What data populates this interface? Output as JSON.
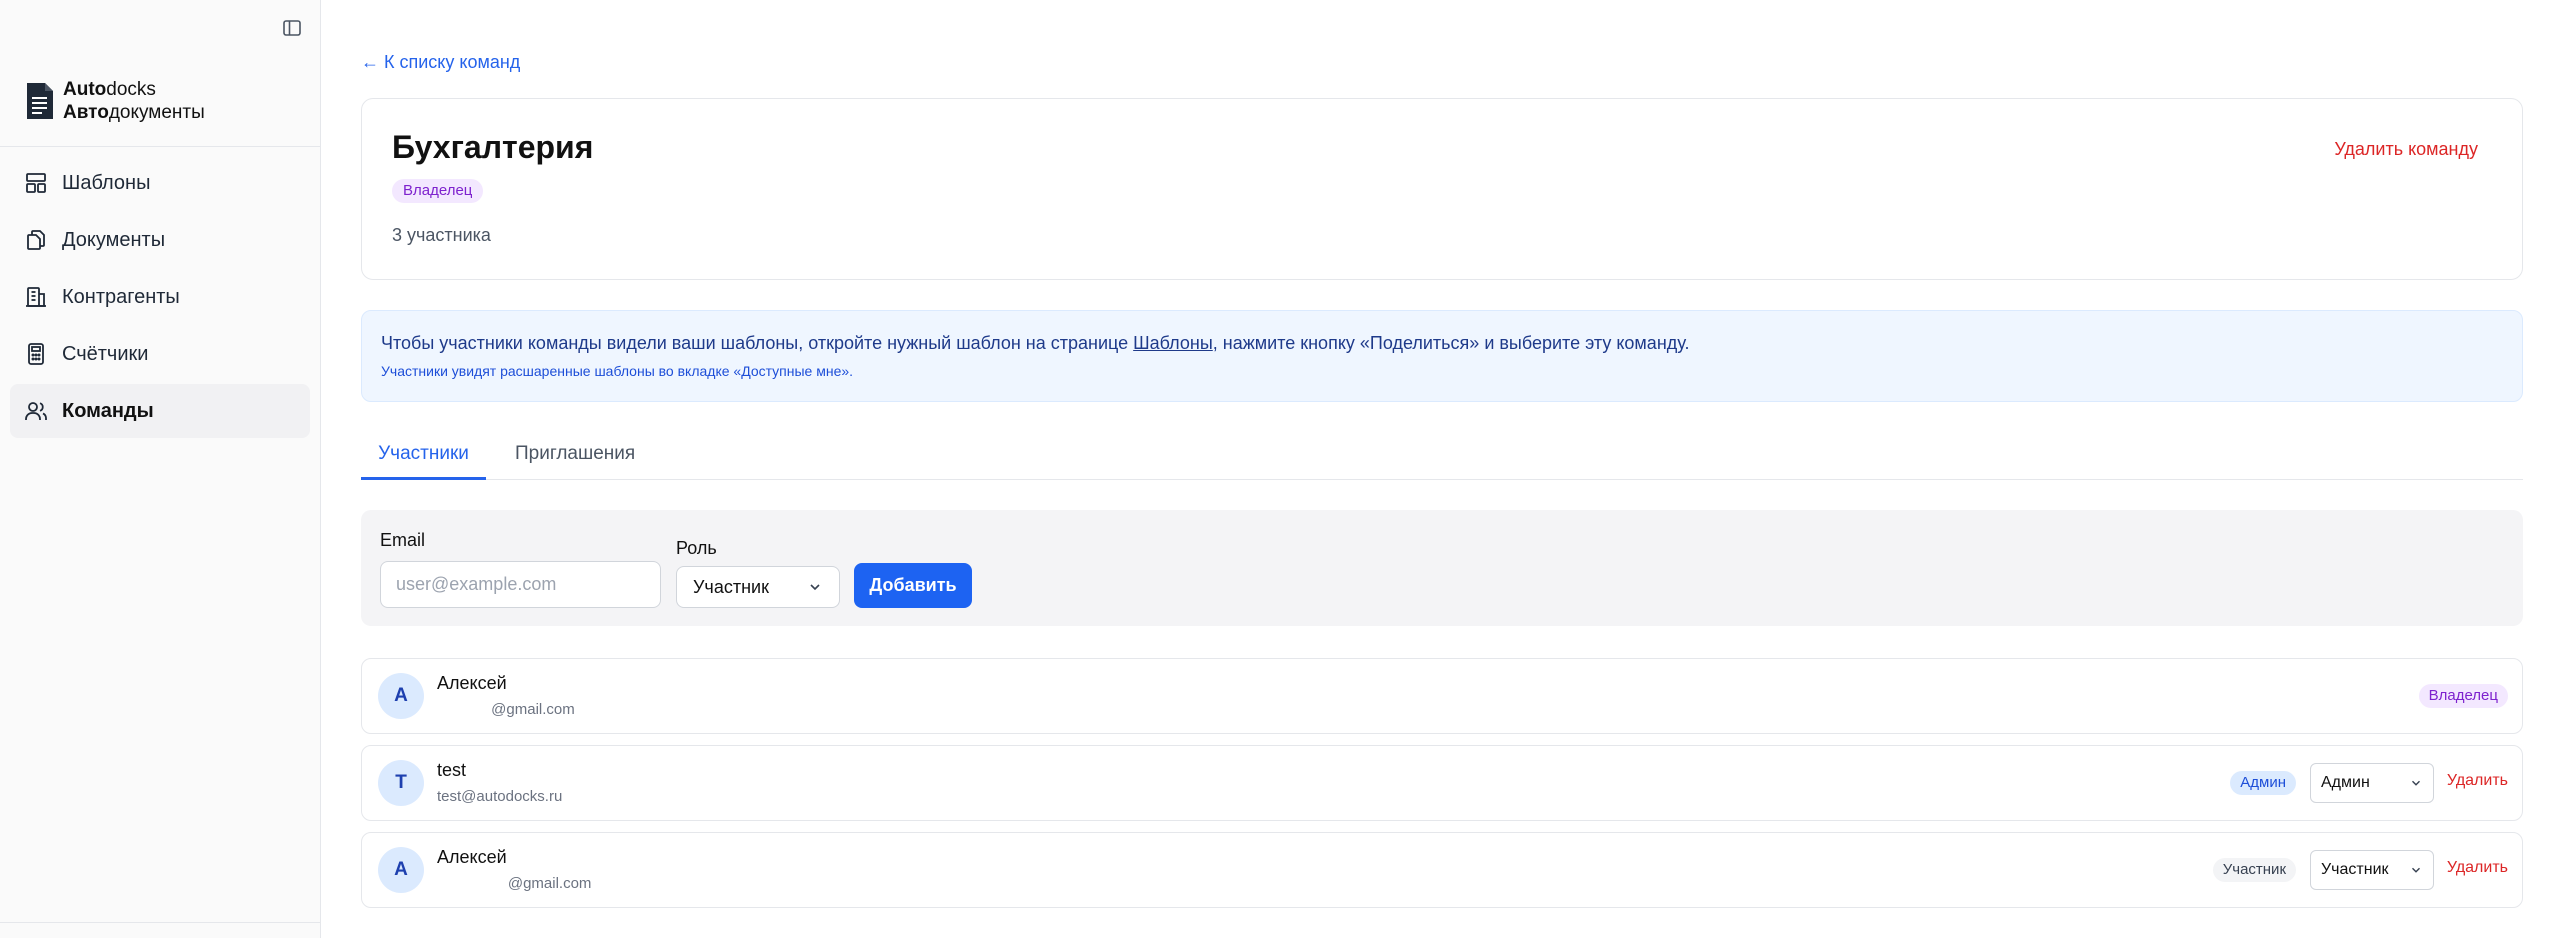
{
  "sidebar": {
    "logo": {
      "line1_bold": "Auto",
      "line1_rest": "docks",
      "line2_bold": "Авто",
      "line2_rest": "документы"
    },
    "items": [
      {
        "label": "Шаблоны",
        "icon": "templates-icon"
      },
      {
        "label": "Документы",
        "icon": "documents-icon"
      },
      {
        "label": "Контрагенты",
        "icon": "building-icon"
      },
      {
        "label": "Счётчики",
        "icon": "calculator-icon"
      },
      {
        "label": "Команды",
        "icon": "users-icon",
        "active": true
      }
    ]
  },
  "main": {
    "back_link": "← К списку команд",
    "team": {
      "name": "Бухгалтерия",
      "role_badge": "Владелец",
      "member_count": "3 участника",
      "delete_label": "Удалить команду"
    },
    "info": {
      "text_before": "Чтобы участники команды видели ваши шаблоны, откройте нужный шаблон на странице ",
      "link": "Шаблоны",
      "text_after": ", нажмите кнопку «Поделиться» и выберите эту команду.",
      "sub": "Участники увидят расшаренные шаблоны во вкладке «Доступные мне»."
    },
    "tabs": [
      {
        "label": "Участники",
        "active": true
      },
      {
        "label": "Приглашения",
        "active": false
      }
    ],
    "add_form": {
      "email_label": "Email",
      "email_placeholder": "user@example.com",
      "role_label": "Роль",
      "role_value": "Участник",
      "add_button": "Добавить"
    },
    "members": [
      {
        "initial": "А",
        "name": "Алексей",
        "email": "             @gmail.com",
        "badge": "Владелец",
        "badge_type": "owner"
      },
      {
        "initial": "T",
        "name": "test",
        "email": "test@autodocks.ru",
        "badge": "Админ",
        "badge_type": "admin",
        "role_select": "Админ",
        "delete": "Удалить"
      },
      {
        "initial": "А",
        "name": "Алексей",
        "email": "                 @gmail.com",
        "badge": "Участник",
        "badge_type": "member",
        "role_select": "Участник",
        "delete": "Удалить"
      }
    ]
  },
  "colors": {
    "accent": "#1d63f2",
    "link": "#2563eb",
    "danger": "#dc2626",
    "owner_badge_bg": "#f3e8ff",
    "admin_badge_bg": "#dbeafe"
  }
}
